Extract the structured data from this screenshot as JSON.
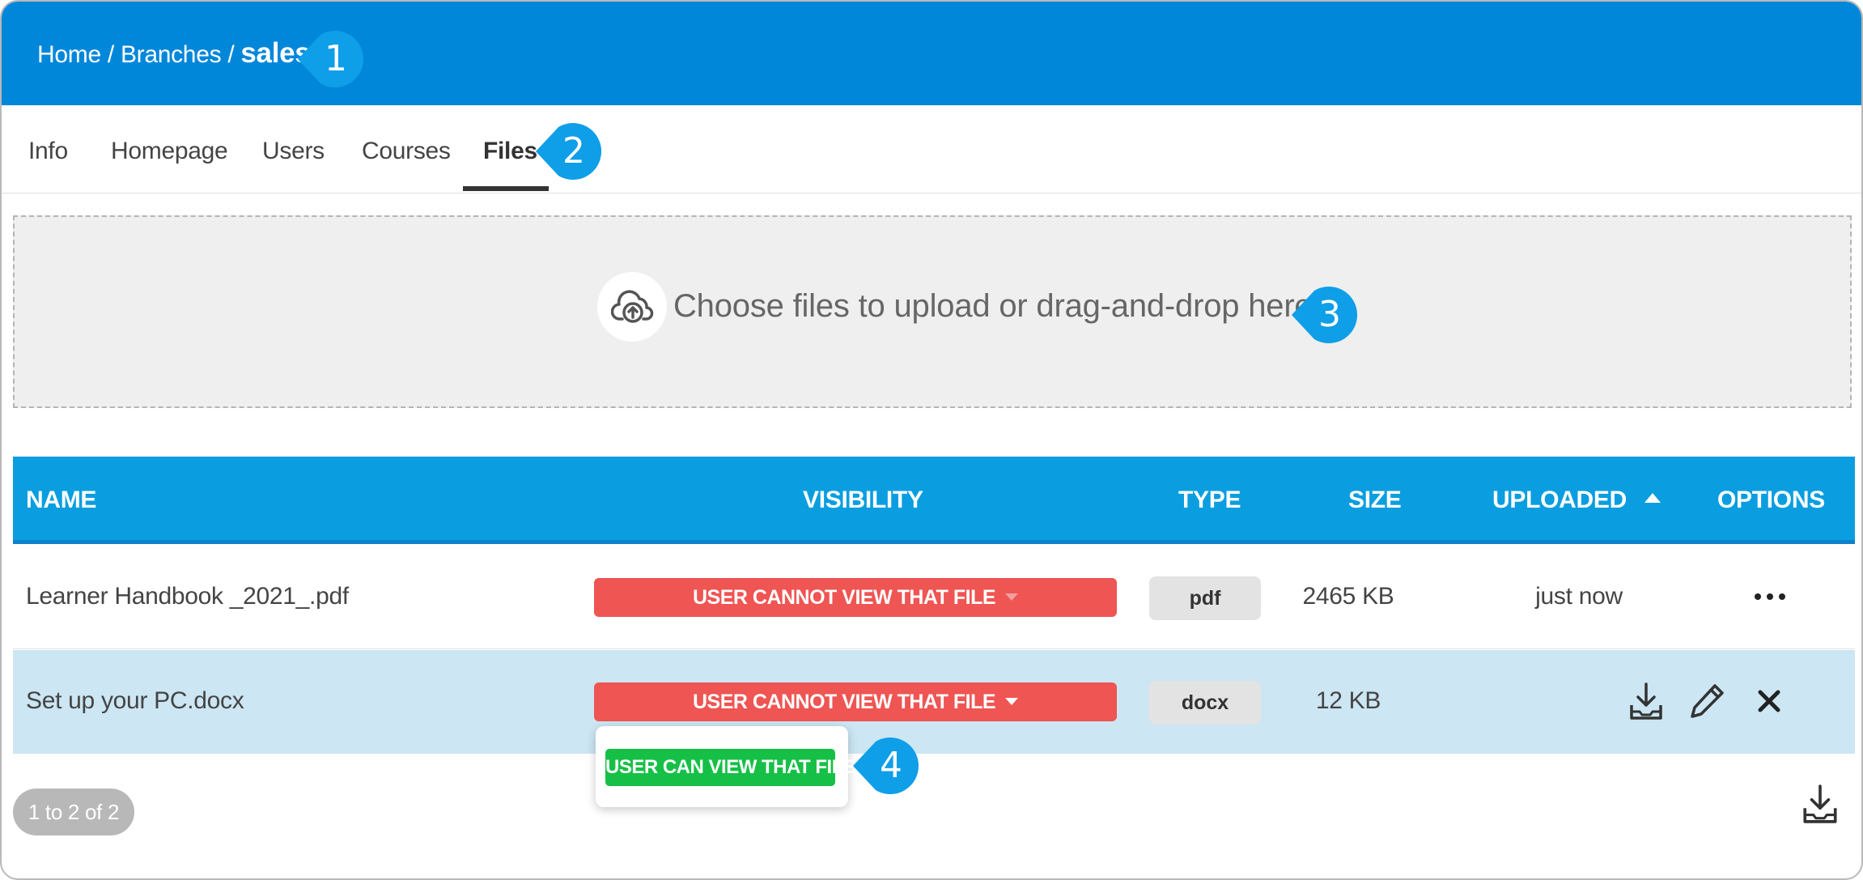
{
  "breadcrumb": {
    "home": "Home",
    "sep1": " / ",
    "branches": "Branches",
    "sep2": " / ",
    "current": "sales"
  },
  "callouts": [
    "1",
    "2",
    "3",
    "4"
  ],
  "tabs": [
    {
      "label": "Info",
      "active": false
    },
    {
      "label": "Homepage",
      "active": false
    },
    {
      "label": "Users",
      "active": false
    },
    {
      "label": "Courses",
      "active": false
    },
    {
      "label": "Files",
      "active": true
    }
  ],
  "upload": {
    "icon": "cloud-upload-icon",
    "text": "Choose files to upload or drag-and-drop here"
  },
  "table": {
    "columns": [
      "NAME",
      "VISIBILITY",
      "TYPE",
      "SIZE",
      "UPLOADED",
      "OPTIONS"
    ],
    "sort": {
      "column": "UPLOADED",
      "direction": "ascending"
    },
    "rows": [
      {
        "name": "Learner Handbook _2021_.pdf",
        "visibility": "USER CANNOT VIEW THAT FILE",
        "type": "pdf",
        "size": "2465 KB",
        "uploaded": "just now",
        "options": "more-options-icon"
      },
      {
        "name": "Set up your PC.docx",
        "visibility": "USER CANNOT VIEW THAT FILE",
        "type": "docx",
        "size": "12 KB",
        "uploaded": "",
        "options": [
          "download-icon",
          "edit-icon",
          "delete-icon"
        ]
      }
    ]
  },
  "visibility_menu": {
    "option": "USER CAN VIEW THAT FILE"
  },
  "pagination": {
    "label": "1 to 2 of 2"
  },
  "colors": {
    "header": "#0087da",
    "table_header": "#0a9ee0",
    "callout": "#0f9ee8",
    "cannot_view": "#ee5553",
    "can_view": "#16c046",
    "row_highlight": "#cce6f3"
  }
}
